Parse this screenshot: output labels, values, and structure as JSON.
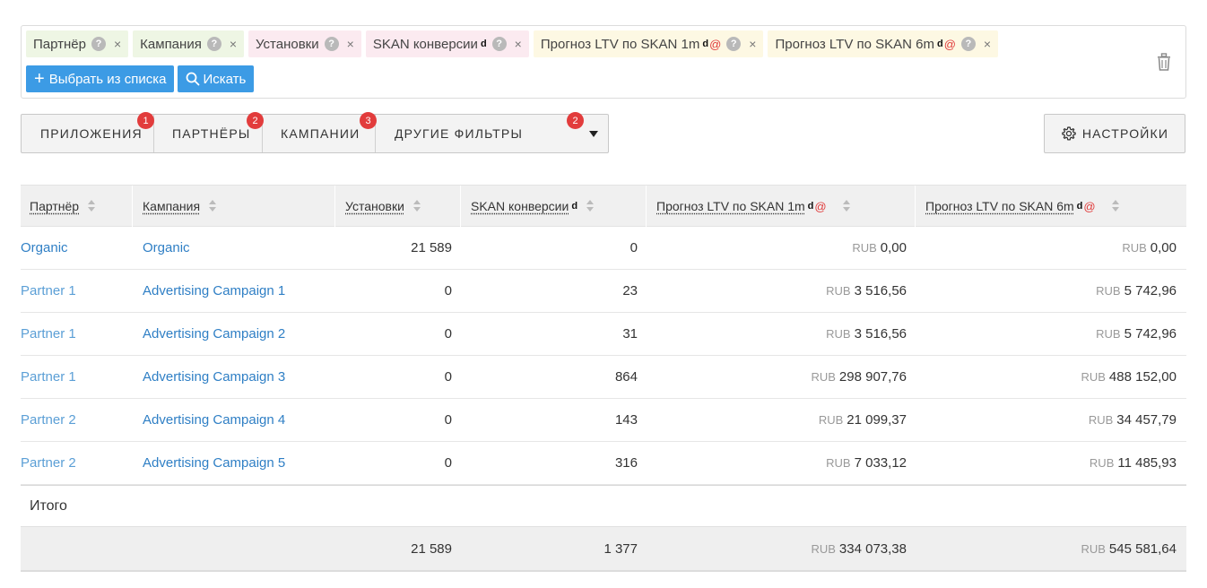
{
  "metrics": {
    "chips": [
      {
        "label": "Партнёр",
        "color": "green",
        "d": false,
        "at": false
      },
      {
        "label": "Кампания",
        "color": "green",
        "d": false,
        "at": false
      },
      {
        "label": "Установки",
        "color": "pink",
        "d": false,
        "at": false
      },
      {
        "label": "SKAN конверсии",
        "color": "pink",
        "d": true,
        "at": false
      },
      {
        "label": "Прогноз LTV по SKAN 1m",
        "color": "yellow",
        "d": true,
        "at": true
      },
      {
        "label": "Прогноз LTV по SKAN 6m",
        "color": "yellow",
        "d": true,
        "at": true
      }
    ],
    "help_glyph": "?",
    "remove_glyph": "×",
    "d_mark": "d",
    "at_mark": "@",
    "select_label": "Выбрать из списка",
    "search_label": "Искать"
  },
  "filters": {
    "tabs": [
      {
        "label": "ПРИЛОЖЕНИЯ",
        "badge": "1"
      },
      {
        "label": "ПАРТНЁРЫ",
        "badge": "2"
      },
      {
        "label": "КАМПАНИИ",
        "badge": "3"
      },
      {
        "label": "ДРУГИЕ ФИЛЬТРЫ",
        "badge": "2"
      }
    ],
    "settings_label": "НАСТРОЙКИ"
  },
  "table": {
    "headers": [
      "Партнёр",
      "Кампания",
      "Установки",
      "SKAN конверсии",
      "Прогноз LTV по SKAN 1m",
      "Прогноз LTV по SKAN 6m"
    ],
    "currency": "RUB",
    "rows": [
      {
        "partner": "Organic",
        "campaign": "Organic",
        "installs": "21 589",
        "skan": "0",
        "ltv1m": "0,00",
        "ltv6m": "0,00"
      },
      {
        "partner": "Partner 1",
        "campaign": "Advertising Campaign 1",
        "installs": "0",
        "skan": "23",
        "ltv1m": "3 516,56",
        "ltv6m": "5 742,96"
      },
      {
        "partner": "Partner 1",
        "campaign": "Advertising Campaign 2",
        "installs": "0",
        "skan": "31",
        "ltv1m": "3 516,56",
        "ltv6m": "5 742,96"
      },
      {
        "partner": "Partner 1",
        "campaign": "Advertising Campaign 3",
        "installs": "0",
        "skan": "864",
        "ltv1m": "298 907,76",
        "ltv6m": "488 152,00"
      },
      {
        "partner": "Partner 2",
        "campaign": "Advertising Campaign 4",
        "installs": "0",
        "skan": "143",
        "ltv1m": "21 099,37",
        "ltv6m": "34 457,79"
      },
      {
        "partner": "Partner 2",
        "campaign": "Advertising Campaign 5",
        "installs": "0",
        "skan": "316",
        "ltv1m": "7 033,12",
        "ltv6m": "11 485,93"
      }
    ],
    "total_label": "Итого",
    "totals": {
      "installs": "21 589",
      "skan": "1 377",
      "ltv1m": "334 073,38",
      "ltv6m": "545 581,64"
    }
  }
}
